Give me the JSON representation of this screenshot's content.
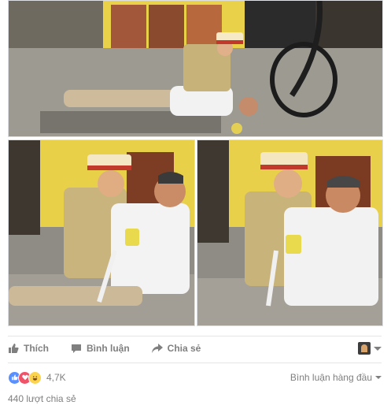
{
  "photos": {
    "top": "Ảnh 1",
    "bottom_left": "Ảnh 2",
    "bottom_right": "Ảnh 3"
  },
  "actions": {
    "like_label": "Thích",
    "comment_label": "Bình luận",
    "share_label": "Chia sẻ"
  },
  "reactions": {
    "count": "4,7K",
    "types": [
      "like",
      "love",
      "haha"
    ]
  },
  "comments": {
    "sort_label": "Bình luận hàng đầu"
  },
  "shares": {
    "label": "440 lượt chia sẻ"
  },
  "colors": {
    "like_blue": "#5890ff",
    "love_red": "#f25268",
    "haha_yellow": "#fcd34d",
    "text_gray": "#7f7f7f"
  }
}
